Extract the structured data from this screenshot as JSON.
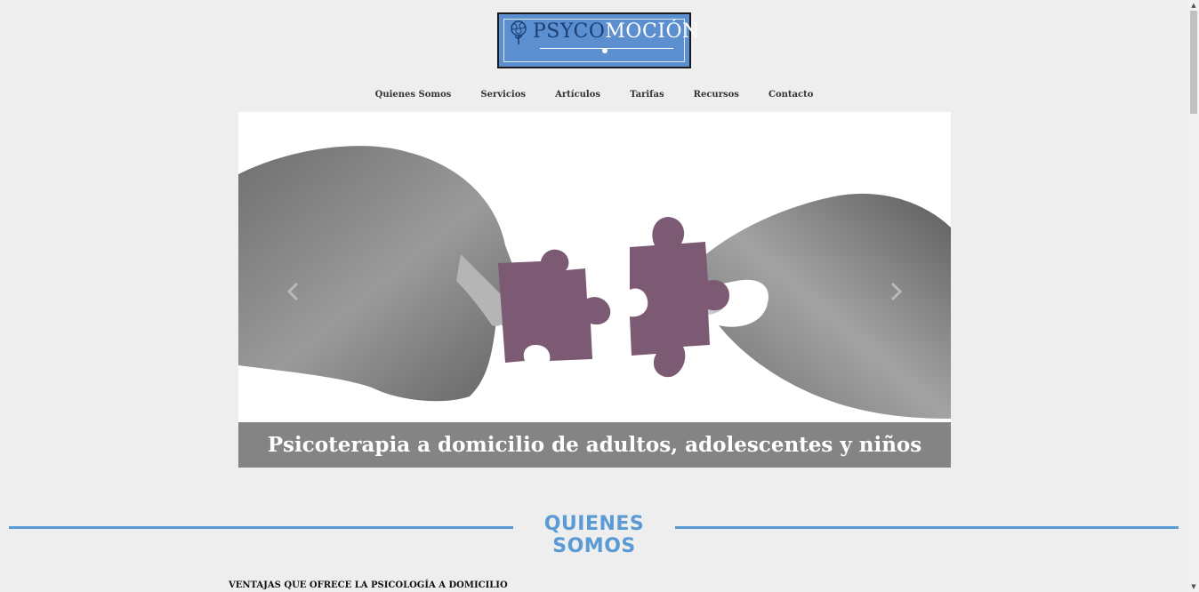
{
  "logo": {
    "text_dark": "PSYCO",
    "text_light": "MOCIÓN",
    "icon": "tree-icon",
    "colors": {
      "background": "#5b8fd0",
      "dark": "#1b3f74",
      "light": "#ffffff"
    }
  },
  "nav": {
    "items": [
      {
        "label": "Quienes Somos"
      },
      {
        "label": "Servicios"
      },
      {
        "label": "Artículos"
      },
      {
        "label": "Tarifas"
      },
      {
        "label": "Recursos"
      },
      {
        "label": "Contacto"
      }
    ]
  },
  "slider": {
    "caption": "Psicoterapia a domicilio de adultos, adolescentes y niños",
    "prev_icon": "chevron-left-icon",
    "next_icon": "chevron-right-icon",
    "image": "hands-joining-puzzle-pieces"
  },
  "section": {
    "title": "QUIENES SOMOS",
    "accent_color": "#5b9bd5",
    "subheading": "VENTAJAS QUE OFRECE LA PSICOLOGÍA A DOMICILIO"
  }
}
